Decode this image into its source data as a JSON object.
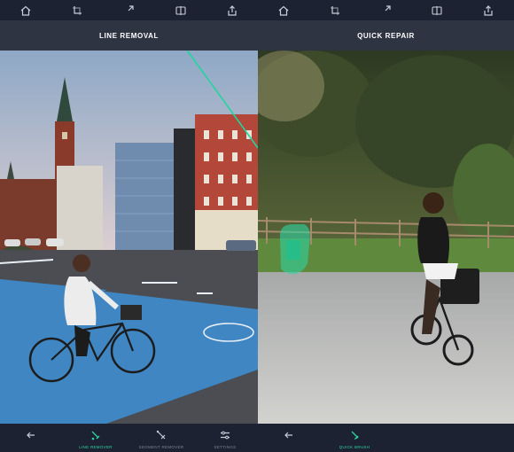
{
  "left_panel": {
    "title": "LINE REMOVAL",
    "top_icons": [
      "home-icon",
      "crop-icon",
      "expand-icon",
      "compare-icon",
      "share-icon"
    ],
    "tools": [
      {
        "name": "back-arrow-icon",
        "label": ""
      },
      {
        "name": "line-remover-icon",
        "label": "LINE REMOVER",
        "active": true
      },
      {
        "name": "segment-remover-icon",
        "label": "SEGMENT REMOVER",
        "active": false
      },
      {
        "name": "settings-icon",
        "label": "SETTINGS",
        "active": false
      }
    ]
  },
  "right_panel": {
    "title": "QUICK REPAIR",
    "top_icons": [
      "home-icon",
      "crop-icon",
      "expand-icon",
      "compare-icon",
      "share-icon"
    ],
    "tools": [
      {
        "name": "back-arrow-icon",
        "label": ""
      },
      {
        "name": "quick-brush-icon",
        "label": "QUICK BRUSH",
        "active": true
      }
    ]
  },
  "colors": {
    "toolbar_bg": "#1c2231",
    "titlebar_bg": "#2e3442",
    "accent": "#2fd4a0",
    "icon": "#c9ced8",
    "inactive_label": "#7d8494"
  }
}
